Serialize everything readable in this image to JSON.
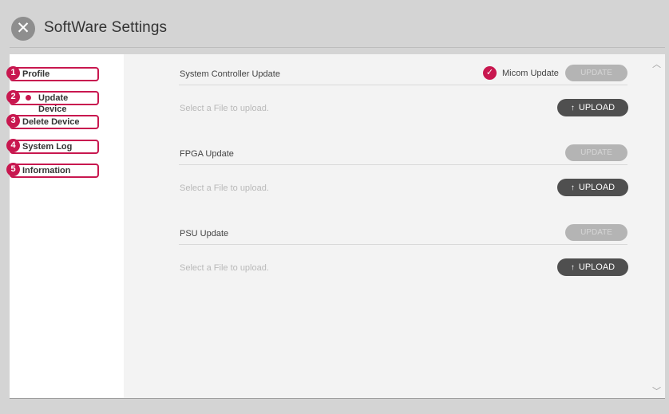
{
  "window": {
    "title": "SoftWare Settings"
  },
  "sidebar": {
    "items": [
      {
        "number": "1",
        "label": "Profile"
      },
      {
        "number": "2",
        "label": "Update Device"
      },
      {
        "number": "3",
        "label": "Delete Device"
      },
      {
        "number": "4",
        "label": "System Log"
      },
      {
        "number": "5",
        "label": "Information"
      }
    ]
  },
  "main": {
    "sections": [
      {
        "title": "System Controller Update",
        "micom_label": "Micom Update",
        "update_label": "UPDATE",
        "placeholder": "Select a File to upload.",
        "upload_label": "UPLOAD"
      },
      {
        "title": "FPGA Update",
        "update_label": "UPDATE",
        "placeholder": "Select a File to upload.",
        "upload_label": "UPLOAD"
      },
      {
        "title": "PSU Update",
        "update_label": "UPDATE",
        "placeholder": "Select a File to upload.",
        "upload_label": "UPLOAD"
      }
    ]
  },
  "colors": {
    "accent": "#c8174f",
    "upload_button": "#4f4f4f",
    "update_button_disabled": "#b4b4b4",
    "background": "#d4d4d4",
    "content_background": "#f3f3f3"
  },
  "icons": {
    "close": "close-icon",
    "upload": "upload-arrow-icon",
    "check": "check-icon",
    "scroll_up": "chevron-up-icon",
    "scroll_down": "chevron-down-icon"
  }
}
